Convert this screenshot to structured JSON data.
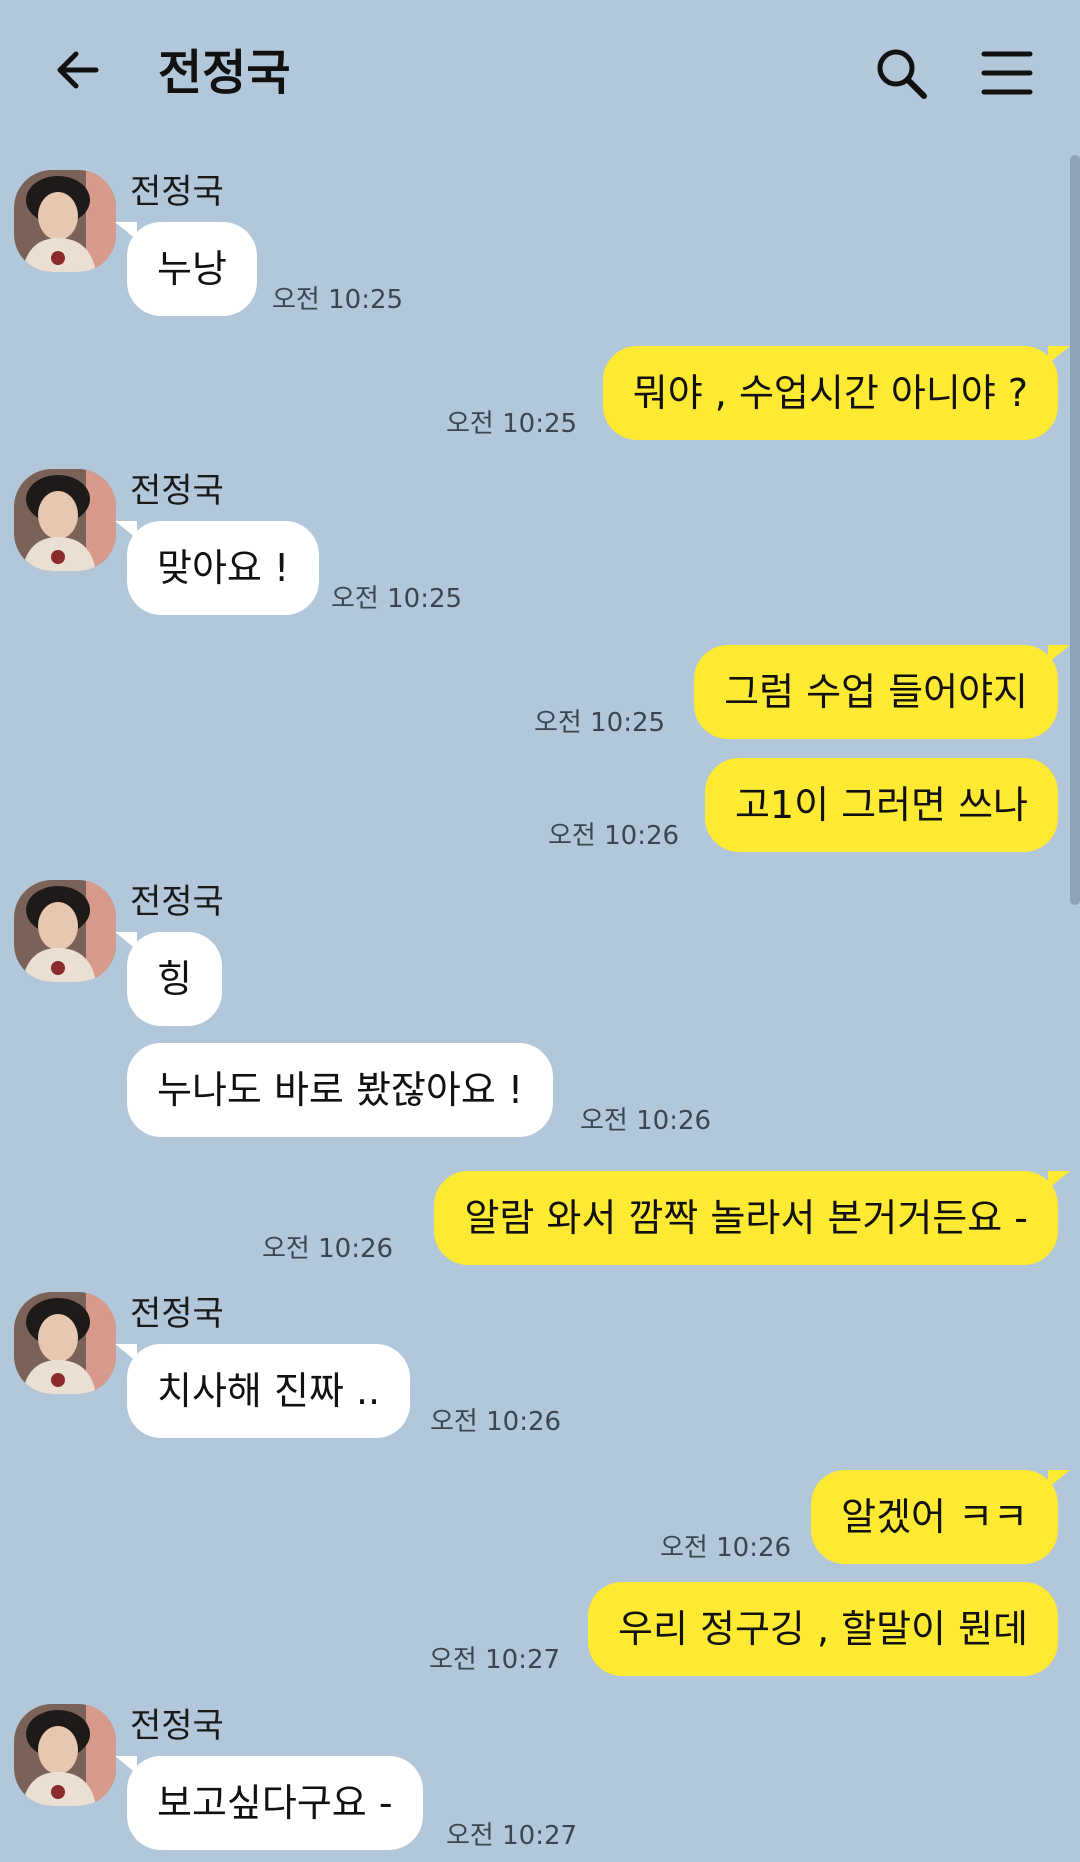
{
  "header": {
    "title": "전정국",
    "back_icon": "arrow-left-icon",
    "search_icon": "search-icon",
    "menu_icon": "hamburger-menu-icon"
  },
  "colors": {
    "background": "#b2c7d9",
    "incoming_bubble": "#ffffff",
    "outgoing_bubble": "#fee933"
  },
  "messages": [
    {
      "sender": "전정국",
      "direction": "in",
      "text": "누낭",
      "time": "오전 10:25"
    },
    {
      "direction": "out",
      "text": "뭐야 , 수업시간 아니야 ?",
      "time": "오전 10:25"
    },
    {
      "sender": "전정국",
      "direction": "in",
      "text": "맞아요 !",
      "time": "오전 10:25"
    },
    {
      "direction": "out",
      "text": "그럼 수업 들어야지",
      "time": "오전 10:25"
    },
    {
      "direction": "out",
      "text": "고1이 그러면 쓰나",
      "time": "오전 10:26"
    },
    {
      "sender": "전정국",
      "direction": "in",
      "text": "힝",
      "time": ""
    },
    {
      "direction": "in",
      "text": "누나도 바로 봤잖아요 !",
      "time": "오전 10:26"
    },
    {
      "direction": "out",
      "text": "알람 와서 깜짝 놀라서 본거거든요 -",
      "time": "오전 10:26"
    },
    {
      "sender": "전정국",
      "direction": "in",
      "text": "치사해 진짜 ..",
      "time": "오전 10:26"
    },
    {
      "direction": "out",
      "text": "알겠어 ㅋㅋ",
      "time": "오전 10:26"
    },
    {
      "direction": "out",
      "text": "우리 정구깅 , 할말이 뭔데",
      "time": "오전 10:27"
    },
    {
      "sender": "전정국",
      "direction": "in",
      "text": "보고싶다구요 -",
      "time": "오전 10:27"
    }
  ]
}
